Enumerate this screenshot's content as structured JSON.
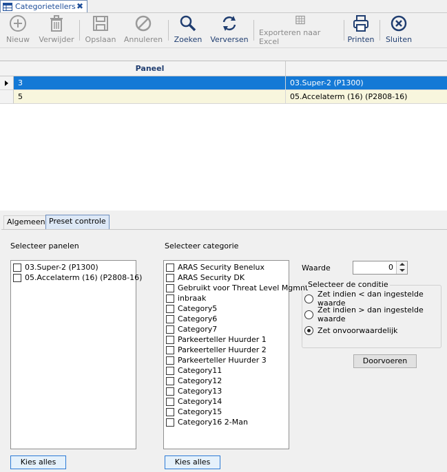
{
  "window": {
    "tab_title": "Categorietellers",
    "close_glyph": "✖"
  },
  "toolbar": {
    "buttons": [
      {
        "label": "Nieuw",
        "icon": "plus-circle-icon",
        "enabled": false
      },
      {
        "label": "Verwijder",
        "icon": "trash-icon",
        "enabled": false
      },
      {
        "label": "Opslaan",
        "icon": "floppy-icon",
        "enabled": false
      },
      {
        "label": "Annuleren",
        "icon": "cancel-icon",
        "enabled": false
      },
      {
        "label": "Zoeken",
        "icon": "search-icon",
        "enabled": true
      },
      {
        "label": "Verversen",
        "icon": "refresh-icon",
        "enabled": true
      },
      {
        "label": "Exporteren naar Excel",
        "icon": "export-excel-icon",
        "enabled": false
      },
      {
        "label": "Printen",
        "icon": "printer-icon",
        "enabled": true
      },
      {
        "label": "Sluiten",
        "icon": "close-circle-icon",
        "enabled": true
      }
    ]
  },
  "grid": {
    "header": "Paneel",
    "rows": [
      {
        "id": "3",
        "name": "03.Super-2 (P1300)",
        "selected": true
      },
      {
        "id": "5",
        "name": "05.Accelaterm (16) (P2808-16)",
        "selected": false
      }
    ]
  },
  "tabs": {
    "algemeen": "Algemeen",
    "preset": "Preset controle",
    "active": "preset"
  },
  "panels": {
    "label": "Selecteer panelen",
    "items": [
      "03.Super-2 (P1300)",
      "05.Accelaterm (16) (P2808-16)"
    ],
    "select_all": "Kies alles"
  },
  "categories": {
    "label": "Selecteer categorie",
    "items": [
      "ARAS Security Benelux",
      "ARAS Security DK",
      "Gebruikt voor Threat Level Mgmnt",
      "inbraak",
      "Category5",
      "Category6",
      "Category7",
      "Parkeerteller Huurder 1",
      "Parkeerteller Huurder 2",
      "Parkeerteller Huurder 3",
      "Category11",
      "Category12",
      "Category13",
      "Category14",
      "Category15",
      "Category16 2-Man"
    ],
    "select_all": "Kies alles"
  },
  "waarde": {
    "label": "Waarde",
    "value": "0"
  },
  "condition": {
    "legend": "Selecteer de conditie",
    "options": [
      "Zet indien < dan ingestelde waarde",
      "Zet indien > dan ingestelde waarde",
      "Zet onvoorwaardelijk"
    ],
    "selected_index": 2
  },
  "apply": {
    "label": "Doorvoeren"
  },
  "colors": {
    "selection": "#1479d6",
    "alt_row": "#f8f6dd",
    "accent": "#1f3d70"
  }
}
